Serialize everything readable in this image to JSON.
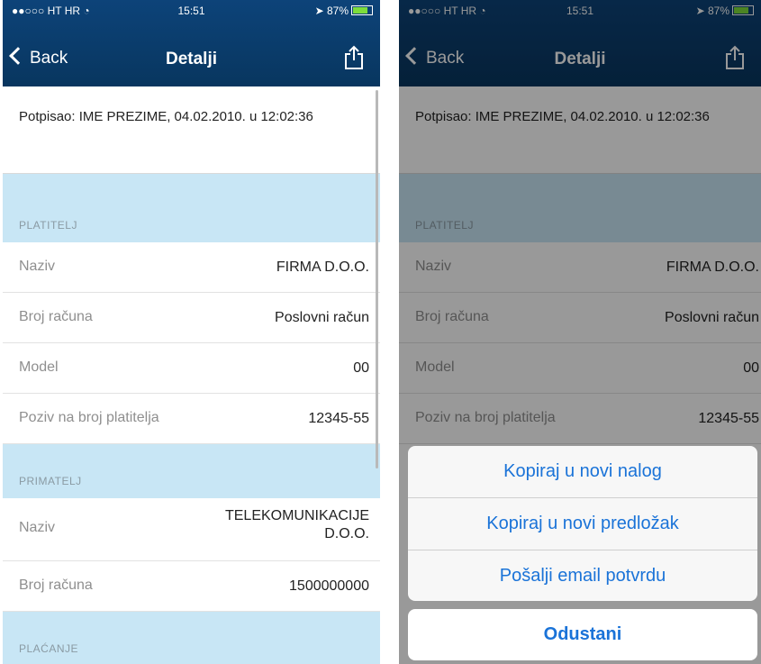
{
  "status": {
    "carrier": "HT HR",
    "time": "15:51",
    "battery": "87%"
  },
  "nav": {
    "back_label": "Back",
    "title": "Detalji"
  },
  "signed": "Potpisao: IME PREZIME, 04.02.2010. u 12:02:36",
  "payer": {
    "section": "PLATITELJ",
    "rows": [
      {
        "label": "Naziv",
        "value": "FIRMA D.O.O."
      },
      {
        "label": "Broj računa",
        "value": "Poslovni račun"
      },
      {
        "label": "Model",
        "value": "00"
      },
      {
        "label": "Poziv na broj platitelja",
        "value": "12345-55"
      }
    ]
  },
  "recipient": {
    "section": "PRIMATELJ",
    "rows": [
      {
        "label": "Naziv",
        "value": "TELEKOMUNIKACIJE D.O.O."
      },
      {
        "label": "Broj računa",
        "value": "1500000000"
      }
    ]
  },
  "payment": {
    "section": "PLAĆANJE"
  },
  "action_sheet": {
    "options": [
      "Kopiraj u novi nalog",
      "Kopiraj u novi predložak",
      "Pošalji email potvrdu"
    ],
    "cancel": "Odustani"
  },
  "colors": {
    "header": "#0a3b6e",
    "section_bg": "#c8e6f5",
    "action": "#1a73d8"
  }
}
